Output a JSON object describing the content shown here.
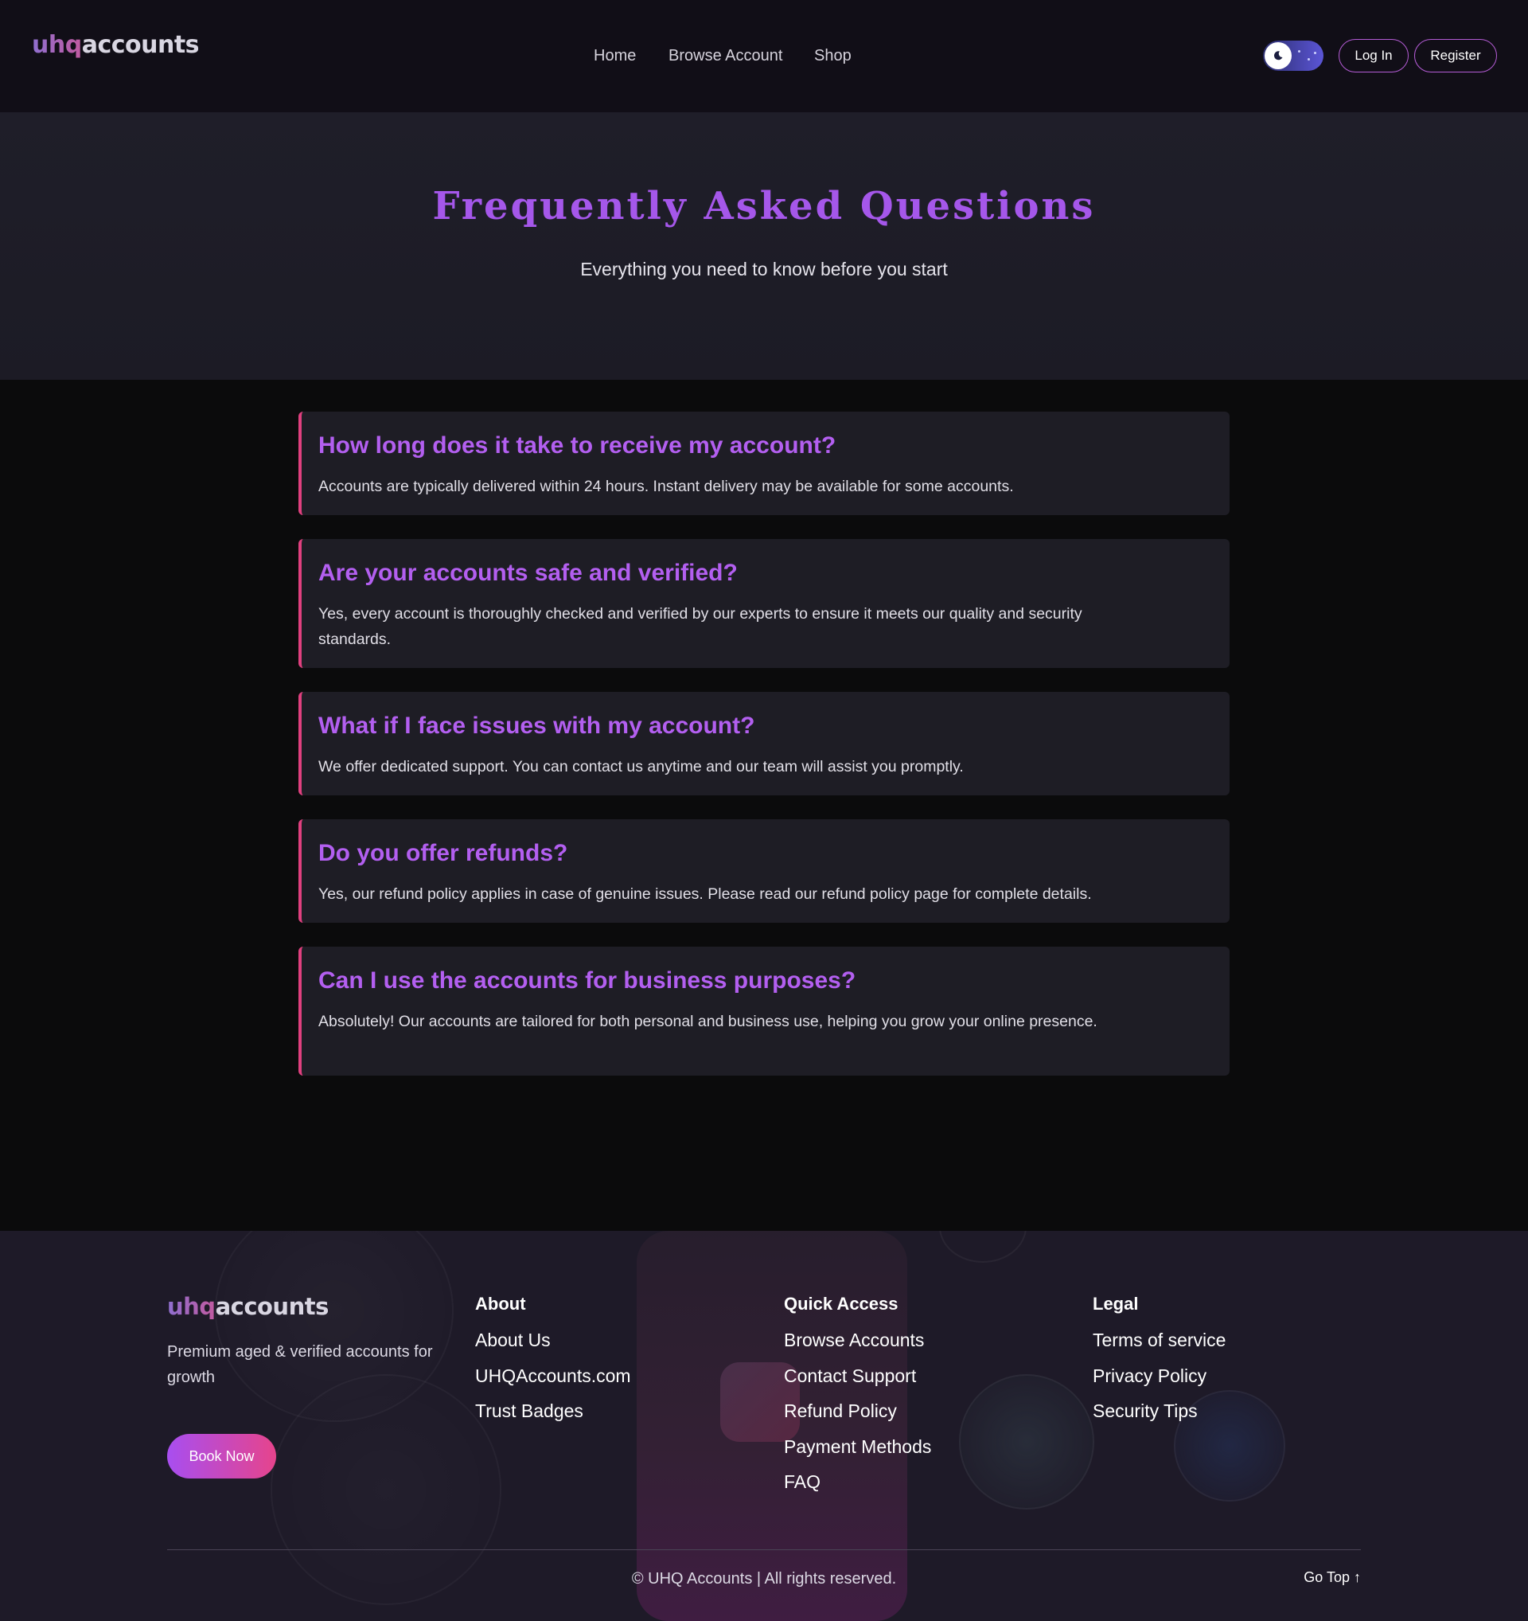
{
  "header": {
    "logo_part1": "uhq",
    "logo_part2": "accounts",
    "nav": [
      "Home",
      "Browse Account",
      "Shop"
    ],
    "theme_toggle_icon": "moon-icon",
    "login_label": "Log In",
    "register_label": "Register"
  },
  "hero": {
    "title": "Frequently Asked Questions",
    "subtitle": "Everything you need to know before you start"
  },
  "faq": [
    {
      "question": "How long does it take to receive my account?",
      "answer": "Accounts are typically delivered within 24 hours. Instant delivery may be available for some accounts."
    },
    {
      "question": "Are your accounts safe and verified?",
      "answer": "Yes, every account is thoroughly checked and verified by our experts to ensure it meets our quality and security standards."
    },
    {
      "question": "What if I face issues with my account?",
      "answer": "We offer dedicated support. You can contact us anytime and our team will assist you promptly."
    },
    {
      "question": "Do you offer refunds?",
      "answer": "Yes, our refund policy applies in case of genuine issues. Please read our refund policy page for complete details."
    },
    {
      "question": "Can I use the accounts for business purposes?",
      "answer": "Absolutely! Our accounts are tailored for both personal and business use, helping you grow your online presence."
    }
  ],
  "footer": {
    "logo_part1": "uhq",
    "logo_part2": "accounts",
    "tagline": "Premium aged & verified accounts for growth",
    "book_label": "Book Now",
    "about": {
      "heading": "About",
      "links": [
        "About Us",
        "UHQAccounts.com",
        "Trust Badges"
      ]
    },
    "quick": {
      "heading": "Quick Access",
      "links": [
        "Browse Accounts",
        "Contact Support",
        "Refund Policy",
        "Payment Methods",
        "FAQ"
      ]
    },
    "legal": {
      "heading": "Legal",
      "links": [
        "Terms of service",
        "Privacy Policy",
        "Security Tips"
      ]
    },
    "copyright": "© UHQ Accounts | All rights reserved.",
    "go_top": "Go Top ↑"
  },
  "colors": {
    "accent_purple": "#a557ea",
    "accent_pink": "#e0407f",
    "header_bg": "#110e17",
    "page_bg": "#0b0b0c",
    "card_bg": "#1e1d25"
  }
}
